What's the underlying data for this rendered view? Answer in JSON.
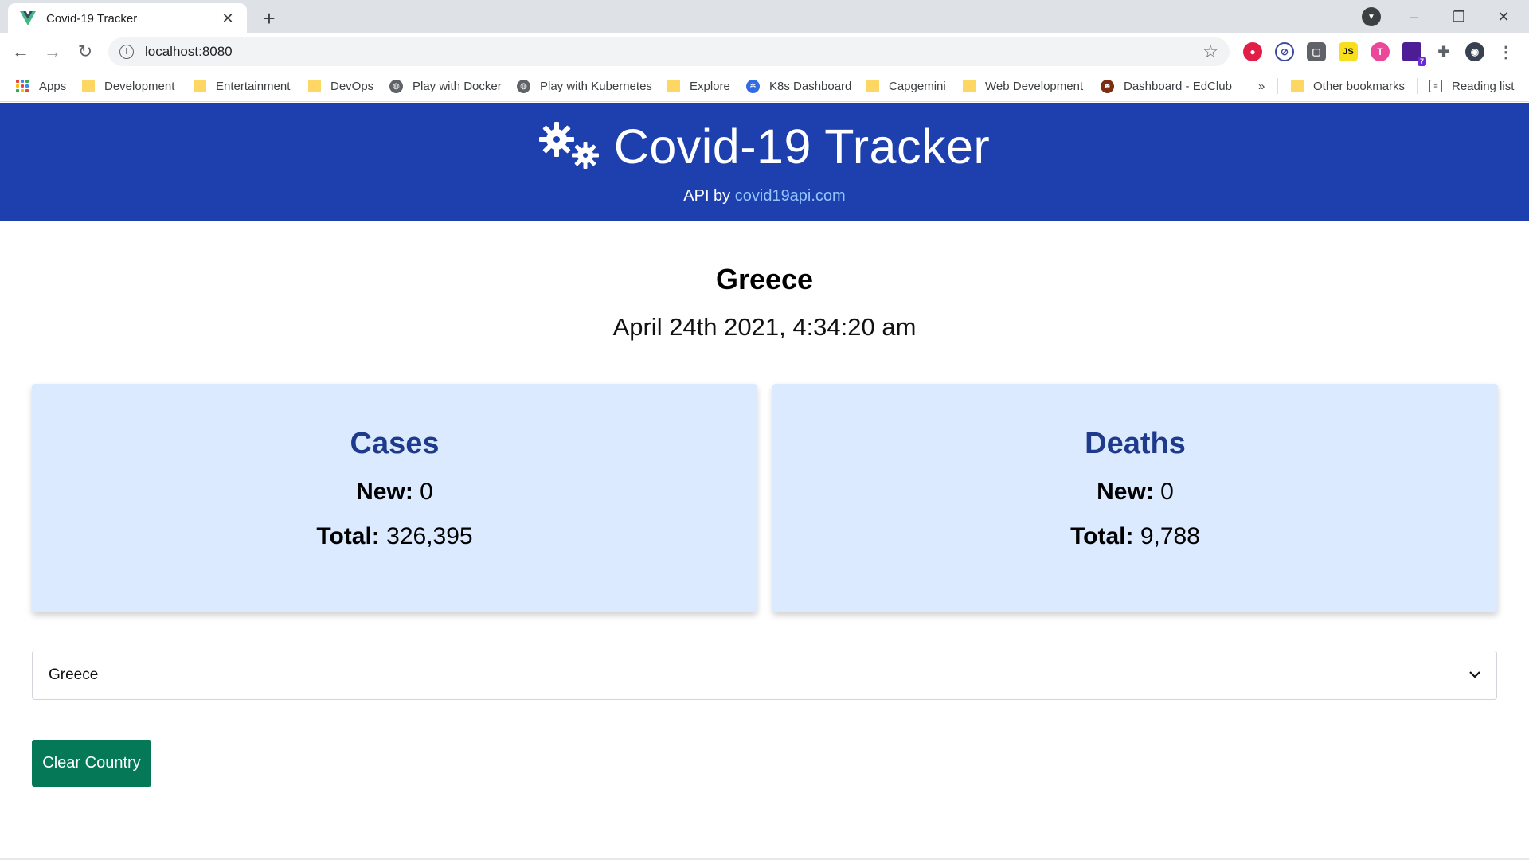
{
  "browser": {
    "tab_title": "Covid-19 Tracker",
    "new_tab_symbol": "+",
    "url": "localhost:8080",
    "tab_close_symbol": "✕",
    "window_controls": [
      "–",
      "❐",
      "✕"
    ],
    "extension_badge": "7",
    "bookmarks": [
      {
        "label": "Apps",
        "icon": "apps-grid-icon"
      },
      {
        "label": "Development",
        "icon": "folder-icon"
      },
      {
        "label": "Entertainment",
        "icon": "folder-icon"
      },
      {
        "label": "DevOps",
        "icon": "folder-icon"
      },
      {
        "label": "Play with Docker",
        "icon": "globe-icon"
      },
      {
        "label": "Play with Kubernetes",
        "icon": "globe-icon"
      },
      {
        "label": "Explore",
        "icon": "folder-icon"
      },
      {
        "label": "K8s Dashboard",
        "icon": "kubernetes-icon"
      },
      {
        "label": "Capgemini",
        "icon": "folder-icon"
      },
      {
        "label": "Web Development",
        "icon": "folder-icon"
      },
      {
        "label": "Dashboard - EdClub",
        "icon": "edclub-icon"
      }
    ],
    "bookmarks_overflow": "»",
    "other_bookmarks": "Other bookmarks",
    "reading_list": "Reading list"
  },
  "header": {
    "title": "Covid-19 Tracker",
    "api_prefix": "API by",
    "api_link": "covid19api.com",
    "icon": "virus-cogs-icon"
  },
  "summary": {
    "country": "Greece",
    "date": "April 24th 2021, 4:34:20 am"
  },
  "cards": {
    "cases": {
      "title": "Cases",
      "new_label": "New:",
      "new_value": "0",
      "total_label": "Total:",
      "total_value": "326,395"
    },
    "deaths": {
      "title": "Deaths",
      "new_label": "New:",
      "new_value": "0",
      "total_label": "Total:",
      "total_value": "9,788"
    }
  },
  "country_select": {
    "selected": "Greece"
  },
  "clear_button": {
    "label": "Clear Country"
  },
  "colors": {
    "header_bg": "#1e40af",
    "card_bg": "#dbeafe",
    "card_title": "#1e3a8a",
    "button_bg": "#047857",
    "link": "#93c5fd"
  }
}
